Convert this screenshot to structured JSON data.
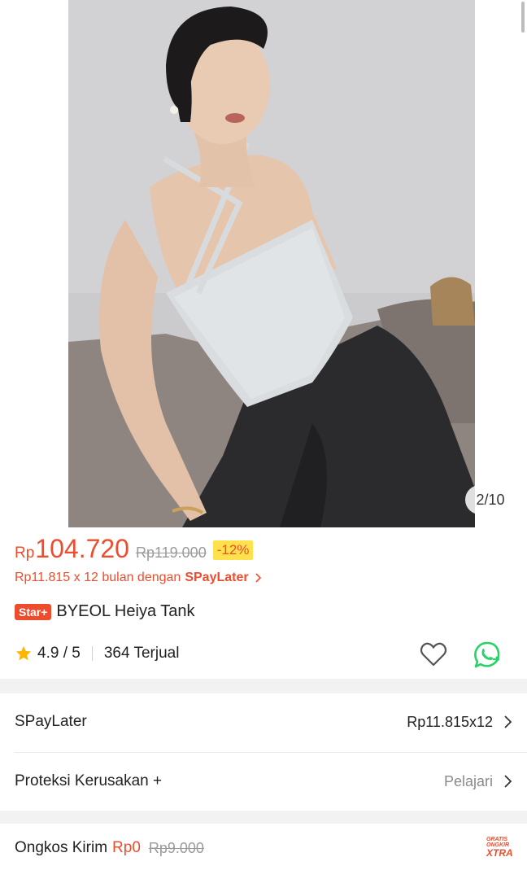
{
  "gallery": {
    "counter": "2/10",
    "image_alt": "woman wearing grey halter tank top and black pants"
  },
  "price": {
    "currency": "Rp",
    "current": "104.720",
    "original": "Rp119.000",
    "discount": "-12%"
  },
  "paylater_promo": {
    "text": "Rp11.815 x 12 bulan dengan",
    "brand": "SPayLater"
  },
  "product": {
    "badge": "Star+",
    "title": "BYEOL Heiya Tank"
  },
  "rating": {
    "score": "4.9 / 5",
    "sold": "364 Terjual"
  },
  "rows": {
    "spaylater_label": "SPayLater",
    "spaylater_value": "Rp11.815x12",
    "protection_label": "Proteksi Kerusakan +",
    "protection_value": "Pelajari"
  },
  "shipping": {
    "label": "Ongkos Kirim",
    "free": "Rp0",
    "original": "Rp9.000",
    "badge_top": "GRATIS ONGKIR",
    "badge_bottom": "XTRA"
  },
  "colors": {
    "accent": "#ee4d2d",
    "discount_bg": "#ffe14d",
    "whatsapp": "#25d366",
    "star": "#ffb400"
  }
}
